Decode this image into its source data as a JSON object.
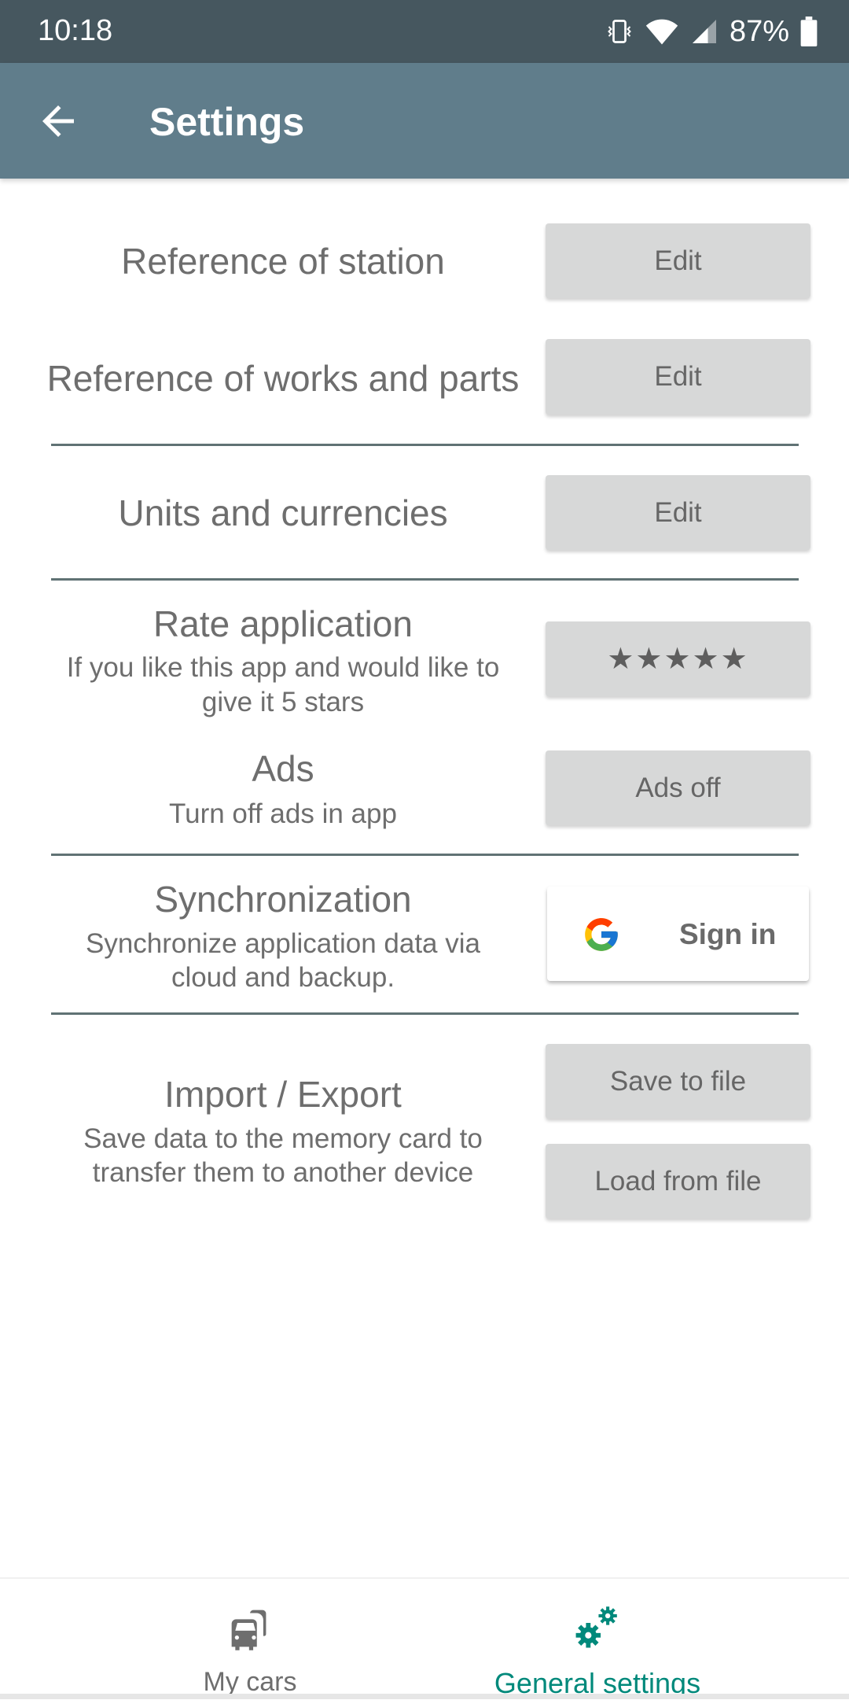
{
  "status_bar": {
    "time": "10:18",
    "battery_percent": "87%",
    "icons": [
      "vibrate-icon",
      "wifi-icon",
      "cell-signal-icon",
      "battery-icon"
    ]
  },
  "toolbar": {
    "back_icon": "arrow-left-icon",
    "title": "Settings"
  },
  "settings": {
    "reference_station": {
      "title": "Reference of station",
      "button": "Edit"
    },
    "reference_works": {
      "title": "Reference of works and parts",
      "button": "Edit"
    },
    "units": {
      "title": "Units and currencies",
      "button": "Edit"
    },
    "rate": {
      "title": "Rate application",
      "subtitle_line1": "If you like this app and would like to",
      "subtitle_line2": "give it 5 stars",
      "button": "★★★★★",
      "rating": 5
    },
    "ads": {
      "title": "Ads",
      "subtitle": "Turn off ads in app",
      "button": "Ads off"
    },
    "sync": {
      "title": "Synchronization",
      "subtitle_line1": "Synchronize application data via",
      "subtitle_line2": "cloud and backup.",
      "button": "Sign in",
      "button_icon": "google-icon"
    },
    "import_export": {
      "title": "Import / Export",
      "subtitle_line1": "Save data to the memory card to",
      "subtitle_line2": "transfer them to another device",
      "save_button": "Save to file",
      "load_button": "Load from file"
    }
  },
  "bottom_nav": {
    "items": [
      {
        "label": "My cars",
        "icon": "cars-icon",
        "active": false
      },
      {
        "label": "General settings",
        "icon": "gears-icon",
        "active": true
      }
    ],
    "active_color": "#00897b",
    "inactive_color": "#6e6e6e"
  }
}
